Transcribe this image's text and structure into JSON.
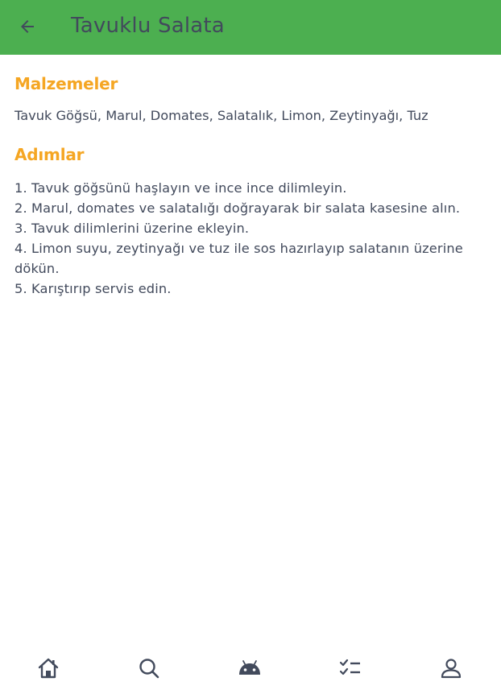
{
  "header": {
    "title": "Tavuklu Salata",
    "back_icon": "arrow-left-icon",
    "background_color": "#4caf50"
  },
  "ingredients": {
    "heading": "Malzemeler",
    "text": "Tavuk Göğsü, Marul, Domates, Salatalık, Limon, Zeytinyağı, Tuz"
  },
  "steps": {
    "heading": "Adımlar",
    "items": [
      "1. Tavuk göğsünü haşlayın ve ince ince dilimleyin.",
      "2. Marul, domates ve salatalığı doğrayarak bir salata kasesine alın.",
      "3. Tavuk dilimlerini üzerine ekleyin.",
      "4. Limon suyu, zeytinyağı ve tuz ile sos hazırlayıp salatanın üzerine dökün.",
      "5. Karıştırıp servis edin."
    ]
  },
  "colors": {
    "accent": "#f5a623",
    "text": "#424a5c"
  },
  "bottom_nav": {
    "items": [
      {
        "icon": "home-icon"
      },
      {
        "icon": "search-icon"
      },
      {
        "icon": "android-icon"
      },
      {
        "icon": "checklist-icon"
      },
      {
        "icon": "person-icon"
      }
    ]
  }
}
